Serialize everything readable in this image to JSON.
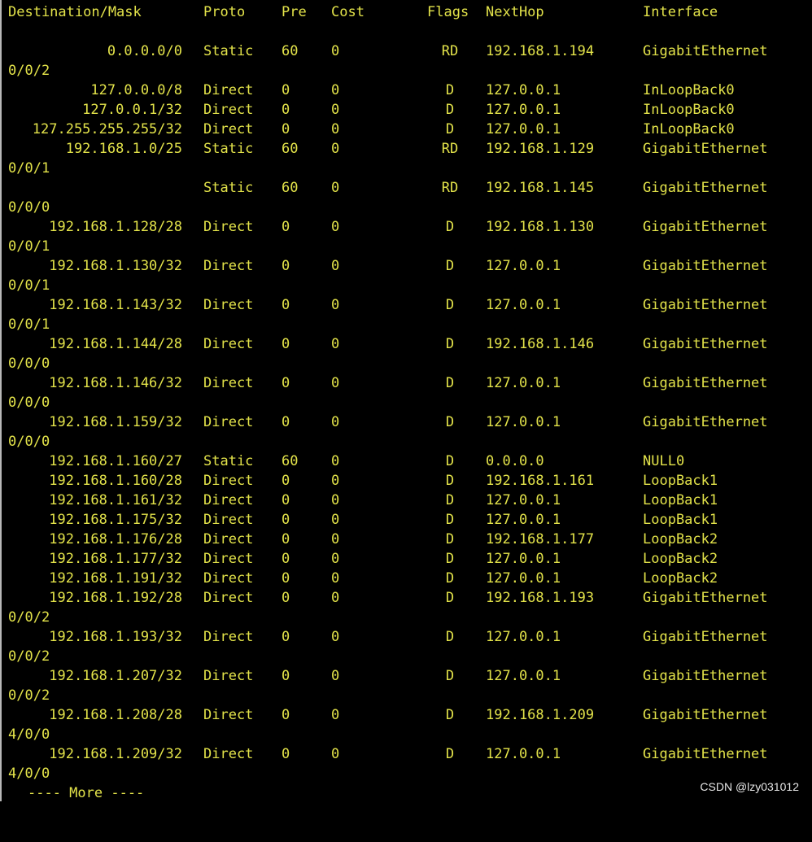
{
  "colors": {
    "background": "#000000",
    "text": "#e3e34a",
    "watermark": "#ffffff"
  },
  "header": {
    "destination": "Destination/Mask",
    "proto": "Proto",
    "pre": "Pre",
    "cost": "Cost",
    "flags": "Flags",
    "nexthop": "NextHop",
    "interface": "Interface"
  },
  "routes": [
    {
      "dest": "0.0.0.0/0",
      "proto": "Static",
      "pre": "60",
      "cost": "0",
      "flags": "RD",
      "nexthop": "192.168.1.194",
      "iface": "GigabitEthernet",
      "wrap": "0/0/2"
    },
    {
      "dest": "127.0.0.0/8",
      "proto": "Direct",
      "pre": "0",
      "cost": "0",
      "flags": "D",
      "nexthop": "127.0.0.1",
      "iface": "InLoopBack0",
      "wrap": ""
    },
    {
      "dest": "127.0.0.1/32",
      "proto": "Direct",
      "pre": "0",
      "cost": "0",
      "flags": "D",
      "nexthop": "127.0.0.1",
      "iface": "InLoopBack0",
      "wrap": ""
    },
    {
      "dest": "127.255.255.255/32",
      "proto": "Direct",
      "pre": "0",
      "cost": "0",
      "flags": "D",
      "nexthop": "127.0.0.1",
      "iface": "InLoopBack0",
      "wrap": ""
    },
    {
      "dest": "192.168.1.0/25",
      "proto": "Static",
      "pre": "60",
      "cost": "0",
      "flags": "RD",
      "nexthop": "192.168.1.129",
      "iface": "GigabitEthernet",
      "wrap": "0/0/1"
    },
    {
      "dest": "",
      "proto": "Static",
      "pre": "60",
      "cost": "0",
      "flags": "RD",
      "nexthop": "192.168.1.145",
      "iface": "GigabitEthernet",
      "wrap": "0/0/0"
    },
    {
      "dest": "192.168.1.128/28",
      "proto": "Direct",
      "pre": "0",
      "cost": "0",
      "flags": "D",
      "nexthop": "192.168.1.130",
      "iface": "GigabitEthernet",
      "wrap": "0/0/1"
    },
    {
      "dest": "192.168.1.130/32",
      "proto": "Direct",
      "pre": "0",
      "cost": "0",
      "flags": "D",
      "nexthop": "127.0.0.1",
      "iface": "GigabitEthernet",
      "wrap": "0/0/1"
    },
    {
      "dest": "192.168.1.143/32",
      "proto": "Direct",
      "pre": "0",
      "cost": "0",
      "flags": "D",
      "nexthop": "127.0.0.1",
      "iface": "GigabitEthernet",
      "wrap": "0/0/1"
    },
    {
      "dest": "192.168.1.144/28",
      "proto": "Direct",
      "pre": "0",
      "cost": "0",
      "flags": "D",
      "nexthop": "192.168.1.146",
      "iface": "GigabitEthernet",
      "wrap": "0/0/0"
    },
    {
      "dest": "192.168.1.146/32",
      "proto": "Direct",
      "pre": "0",
      "cost": "0",
      "flags": "D",
      "nexthop": "127.0.0.1",
      "iface": "GigabitEthernet",
      "wrap": "0/0/0"
    },
    {
      "dest": "192.168.1.159/32",
      "proto": "Direct",
      "pre": "0",
      "cost": "0",
      "flags": "D",
      "nexthop": "127.0.0.1",
      "iface": "GigabitEthernet",
      "wrap": "0/0/0"
    },
    {
      "dest": "192.168.1.160/27",
      "proto": "Static",
      "pre": "60",
      "cost": "0",
      "flags": "D",
      "nexthop": "0.0.0.0",
      "iface": "NULL0",
      "wrap": ""
    },
    {
      "dest": "192.168.1.160/28",
      "proto": "Direct",
      "pre": "0",
      "cost": "0",
      "flags": "D",
      "nexthop": "192.168.1.161",
      "iface": "LoopBack1",
      "wrap": ""
    },
    {
      "dest": "192.168.1.161/32",
      "proto": "Direct",
      "pre": "0",
      "cost": "0",
      "flags": "D",
      "nexthop": "127.0.0.1",
      "iface": "LoopBack1",
      "wrap": ""
    },
    {
      "dest": "192.168.1.175/32",
      "proto": "Direct",
      "pre": "0",
      "cost": "0",
      "flags": "D",
      "nexthop": "127.0.0.1",
      "iface": "LoopBack1",
      "wrap": ""
    },
    {
      "dest": "192.168.1.176/28",
      "proto": "Direct",
      "pre": "0",
      "cost": "0",
      "flags": "D",
      "nexthop": "192.168.1.177",
      "iface": "LoopBack2",
      "wrap": ""
    },
    {
      "dest": "192.168.1.177/32",
      "proto": "Direct",
      "pre": "0",
      "cost": "0",
      "flags": "D",
      "nexthop": "127.0.0.1",
      "iface": "LoopBack2",
      "wrap": ""
    },
    {
      "dest": "192.168.1.191/32",
      "proto": "Direct",
      "pre": "0",
      "cost": "0",
      "flags": "D",
      "nexthop": "127.0.0.1",
      "iface": "LoopBack2",
      "wrap": ""
    },
    {
      "dest": "192.168.1.192/28",
      "proto": "Direct",
      "pre": "0",
      "cost": "0",
      "flags": "D",
      "nexthop": "192.168.1.193",
      "iface": "GigabitEthernet",
      "wrap": "0/0/2"
    },
    {
      "dest": "192.168.1.193/32",
      "proto": "Direct",
      "pre": "0",
      "cost": "0",
      "flags": "D",
      "nexthop": "127.0.0.1",
      "iface": "GigabitEthernet",
      "wrap": "0/0/2"
    },
    {
      "dest": "192.168.1.207/32",
      "proto": "Direct",
      "pre": "0",
      "cost": "0",
      "flags": "D",
      "nexthop": "127.0.0.1",
      "iface": "GigabitEthernet",
      "wrap": "0/0/2"
    },
    {
      "dest": "192.168.1.208/28",
      "proto": "Direct",
      "pre": "0",
      "cost": "0",
      "flags": "D",
      "nexthop": "192.168.1.209",
      "iface": "GigabitEthernet",
      "wrap": "4/0/0"
    },
    {
      "dest": "192.168.1.209/32",
      "proto": "Direct",
      "pre": "0",
      "cost": "0",
      "flags": "D",
      "nexthop": "127.0.0.1",
      "iface": "GigabitEthernet",
      "wrap": "4/0/0"
    }
  ],
  "more_prompt": "---- More ----",
  "watermark": "CSDN @lzy031012"
}
